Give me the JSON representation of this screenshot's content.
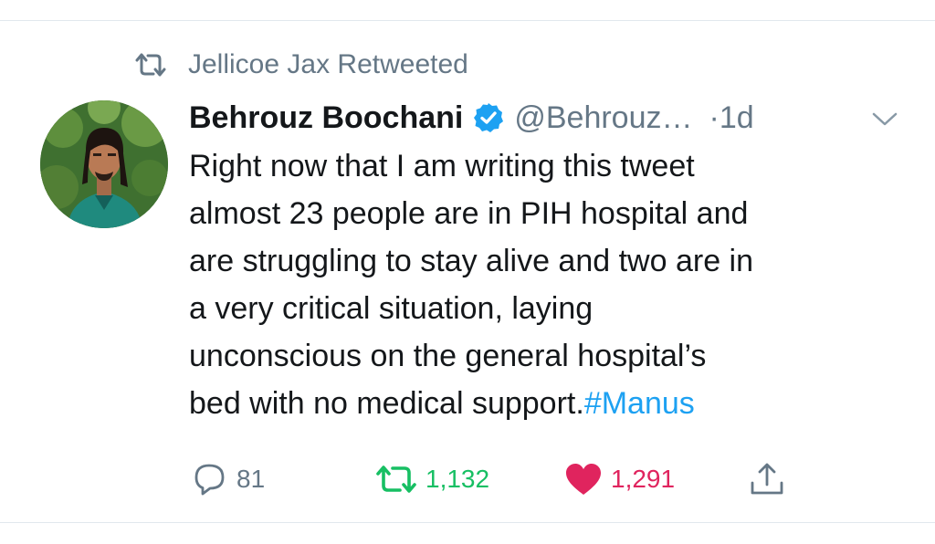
{
  "retweet_context": {
    "icon": "retweet-icon",
    "text": "Jellicoe Jax Retweeted"
  },
  "tweet": {
    "author_name": "Behrouz Boochani",
    "verified": true,
    "handle": "@Behrouz…",
    "time": "·1d",
    "text_lines": [
      "Right now that I am writing this tweet",
      "almost 23 people are in PIH hospital and",
      "are struggling to stay alive and two are in",
      "a very critical situation, laying",
      "unconscious on the general hospital’s",
      "bed with no medical support."
    ],
    "hashtag": "#Manus"
  },
  "actions": {
    "reply_count": "81",
    "retweet_count": "1,132",
    "like_count": "1,291",
    "share_icon": "share-icon"
  },
  "colors": {
    "secondary": "#657786",
    "retweet_active": "#17bf63",
    "like_active": "#e0245e",
    "link": "#1da1f2",
    "verified": "#1da1f2"
  }
}
